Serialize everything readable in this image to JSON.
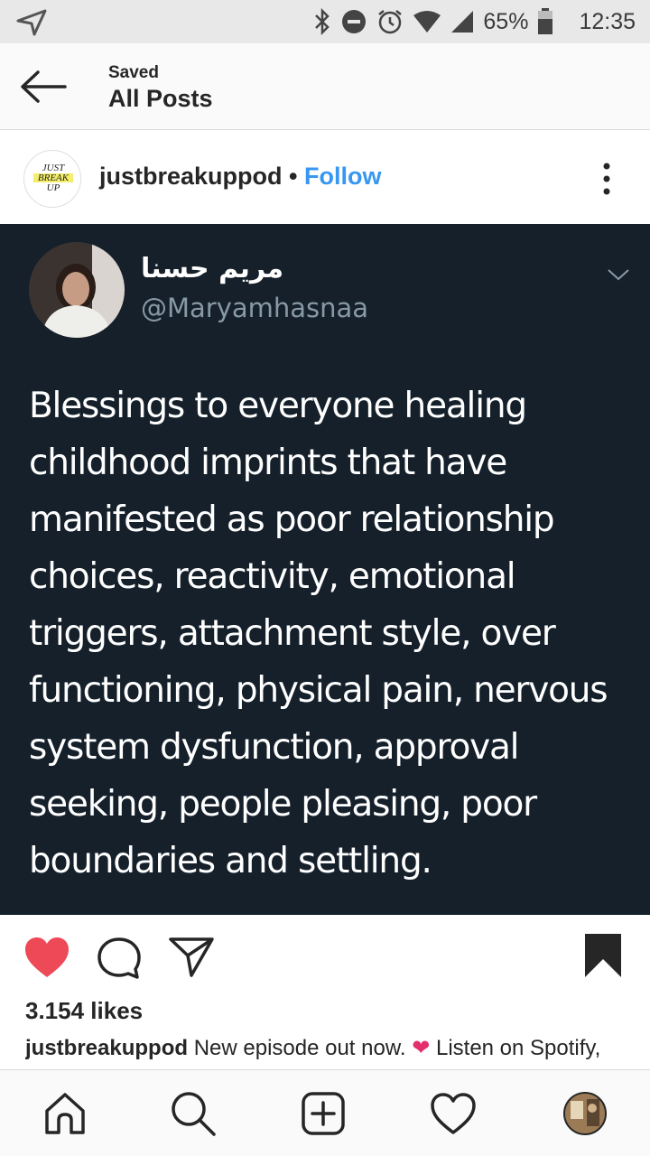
{
  "status_bar": {
    "battery": "65%",
    "time": "12:35"
  },
  "header": {
    "subtitle": "Saved",
    "title": "All Posts"
  },
  "post": {
    "username": "justbreakuppod",
    "separator": "•",
    "follow_label": "Follow",
    "avatar_logo_text": "JUST BREAK UP"
  },
  "tweet": {
    "display_name": "مريم حسنا",
    "handle": "@Maryamhasnaa",
    "lines": [
      "Blessings to everyone healing",
      "childhood imprints that have",
      "manifested as poor relationship",
      "choices, reactivity, emotional",
      "triggers, attachment style, over",
      "functioning, physical pain, nervous",
      "system dysfunction, approval",
      "seeking, people pleasing, poor",
      "boundaries and settling."
    ]
  },
  "likes": "3.154 likes",
  "caption": {
    "username": "justbreakuppod",
    "text_before": "New episode out now.",
    "heart": "❤",
    "text_after": "Listen on Spotify,"
  },
  "colors": {
    "accent": "#3897f0",
    "like_red": "#ed4956",
    "tweet_bg": "#15202b"
  }
}
